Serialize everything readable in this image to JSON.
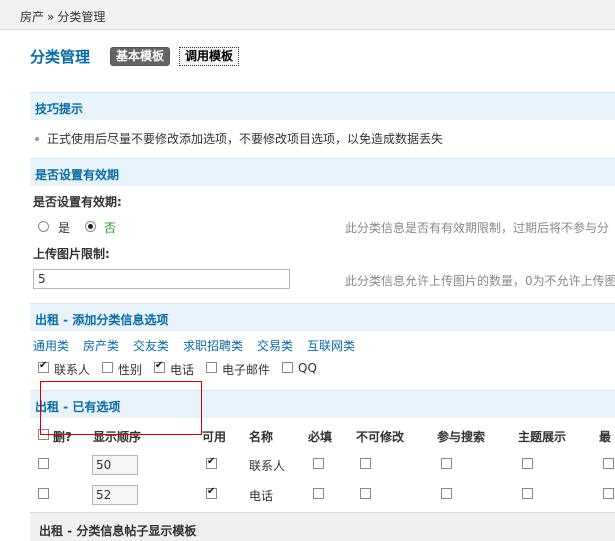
{
  "breadcrumb": {
    "home": "房产",
    "sep": "»",
    "current": "分类管理"
  },
  "header": {
    "title": "分类管理",
    "tab_basic": "基本模板",
    "tab_call": "调用模板"
  },
  "tips": {
    "title": "技巧提示",
    "line": "正式使用后尽量不要修改添加选项，不要修改项目选项，以免造成数据丢失"
  },
  "validity": {
    "section_title": "是否设置有效期",
    "label": "是否设置有效期:",
    "yes": "是",
    "no": "否",
    "selected": "否",
    "hint": "此分类信息是否有有效期限制，过期后将不参与分"
  },
  "image_limit": {
    "label": "上传图片限制:",
    "value": "5",
    "hint": "此分类信息允许上传图片的数量，0为不允许上传图"
  },
  "add_options": {
    "section_title": "出租 - 添加分类信息选项",
    "types": [
      "通用类",
      "房产类",
      "交友类",
      "求职招聘类",
      "交易类",
      "互联网类"
    ],
    "checks": [
      {
        "label": "联系人",
        "checked": true
      },
      {
        "label": "性别",
        "checked": false
      },
      {
        "label": "电话",
        "checked": true
      },
      {
        "label": "电子邮件",
        "checked": false
      },
      {
        "label": "QQ",
        "checked": false
      }
    ]
  },
  "existing": {
    "section_title": "出租 - 已有选项",
    "columns": [
      "删?",
      "显示顺序",
      "可用",
      "名称",
      "必填",
      "不可修改",
      "参与搜索",
      "主题展示",
      "最"
    ],
    "rows": [
      {
        "order": "50",
        "enabled": true,
        "name": "联系人"
      },
      {
        "order": "52",
        "enabled": true,
        "name": "电话"
      }
    ]
  },
  "bottom": {
    "title": "出租 - 分类信息帖子显示模板"
  }
}
